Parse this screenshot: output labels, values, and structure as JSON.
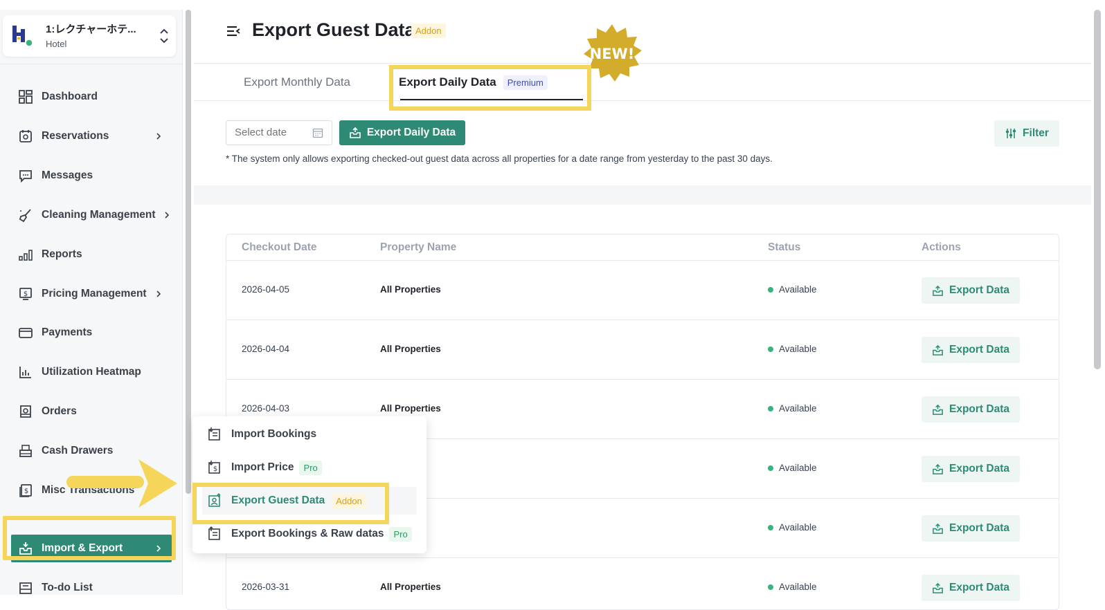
{
  "hotel": {
    "name": "1:レクチャーホテ...",
    "type": "Hotel"
  },
  "sidebar": {
    "items": [
      {
        "label": "Dashboard",
        "icon": "dashboard-icon",
        "chevron": false
      },
      {
        "label": "Reservations",
        "icon": "calendar-icon",
        "chevron": true
      },
      {
        "label": "Messages",
        "icon": "chat-icon",
        "chevron": false
      },
      {
        "label": "Cleaning Management",
        "icon": "broom-icon",
        "chevron": true
      },
      {
        "label": "Reports",
        "icon": "bar-chart-icon",
        "chevron": false
      },
      {
        "label": "Pricing Management",
        "icon": "price-tag-icon",
        "chevron": true
      },
      {
        "label": "Payments",
        "icon": "credit-card-icon",
        "chevron": false
      },
      {
        "label": "Utilization Heatmap",
        "icon": "heatmap-icon",
        "chevron": false
      },
      {
        "label": "Orders",
        "icon": "orders-icon",
        "chevron": false
      },
      {
        "label": "Cash Drawers",
        "icon": "cash-register-icon",
        "chevron": false
      },
      {
        "label": "Misc Transactions",
        "icon": "dollar-doc-icon",
        "chevron": false
      },
      {
        "label": "Import & Export",
        "icon": "inbox-icon",
        "chevron": true,
        "active": true
      },
      {
        "label": "To-do List",
        "icon": "todo-icon",
        "chevron": false
      }
    ]
  },
  "header": {
    "title": "Export Guest Data",
    "badge": "Addon",
    "new_badge": "NEW!"
  },
  "tabs": [
    {
      "label": "Export Monthly Data"
    },
    {
      "label": "Export Daily Data",
      "badge": "Premium",
      "active": true
    }
  ],
  "toolbar": {
    "date_placeholder": "Select date",
    "export_button": "Export Daily Data",
    "filter_button": "Filter",
    "notice": "* The system only allows exporting checked-out guest data across all properties for a date range from yesterday to the past 30 days."
  },
  "table": {
    "headers": [
      "Checkout Date",
      "Property Name",
      "Status",
      "Actions"
    ],
    "rows": [
      {
        "date": "2026-04-05",
        "property": "All Properties",
        "status": "Available",
        "action": "Export Data"
      },
      {
        "date": "2026-04-04",
        "property": "All Properties",
        "status": "Available",
        "action": "Export Data"
      },
      {
        "date": "2026-04-03",
        "property": "All Properties",
        "status": "Available",
        "action": "Export Data"
      },
      {
        "date": "",
        "property": "ties",
        "status": "Available",
        "action": "Export Data"
      },
      {
        "date": "",
        "property": "ties",
        "status": "Available",
        "action": "Export Data"
      },
      {
        "date": "2026-03-31",
        "property": "All Properties",
        "status": "Available",
        "action": "Export Data"
      }
    ]
  },
  "menu": {
    "items": [
      {
        "label": "Import Bookings"
      },
      {
        "label": "Import Price",
        "badge": "Pro"
      },
      {
        "label": "Export Guest Data",
        "badge": "Addon",
        "selected": true
      },
      {
        "label": "Export Bookings & Raw datas",
        "badge": "Pro"
      }
    ]
  },
  "colors": {
    "accent": "#2f8a75",
    "highlight": "#f5d65a",
    "addon": "#d4a01c",
    "pro": "#2f9a62",
    "premium": "#3e4bb8"
  }
}
